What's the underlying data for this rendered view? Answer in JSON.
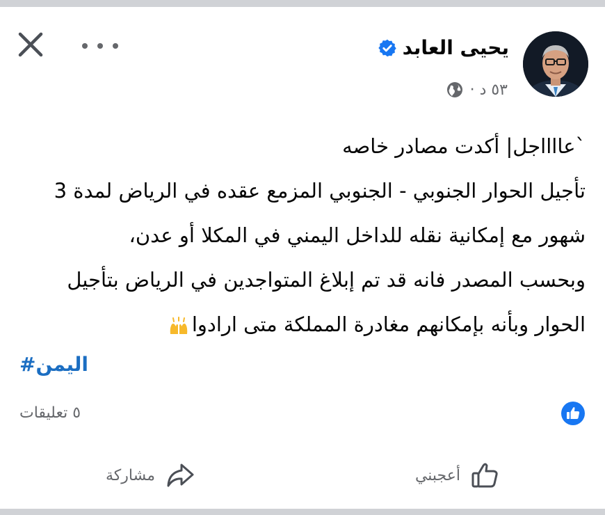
{
  "post": {
    "author": "يحيى العابد",
    "time": "٥٣ د ·",
    "lines": [
      "`عااااجل| أكدت مصادر خاصه",
      "تأجيل الحوار الجنوبي - الجنوبي المزمع عقده في الرياض لمدة 3",
      "شهور مع إمكانية نقله للداخل اليمني في المكلا أو عدن،",
      "وبحسب المصدر فانه قد تم إبلاغ المتواجدين في الرياض بتأجيل",
      "الحوار وبأنه بإمكانهم مغادرة المملكة متى ارادوا"
    ],
    "hashtag": "اليمن#",
    "comments": "٥ تعليقات"
  },
  "actions": {
    "like_label": "أعجبني",
    "share_label": "مشاركة"
  },
  "icons": {
    "close": "close-icon",
    "more": "more-icon",
    "verified": "verified-badge-icon",
    "globe": "globe-icon",
    "emoji": "raising-hands-emoji",
    "like_badge": "like-reaction-icon",
    "like": "thumbs-up-icon",
    "share": "share-arrow-icon"
  },
  "colors": {
    "verified": "#1877f2",
    "hashtag": "#1b6ec2",
    "like_badge": "#1877f2",
    "secondary_text": "#65676b"
  }
}
